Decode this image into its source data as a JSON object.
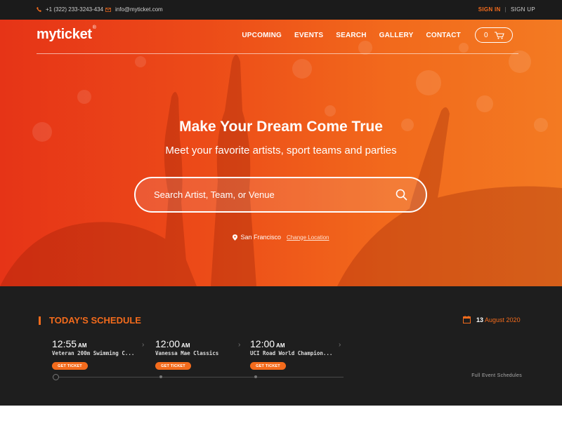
{
  "topbar": {
    "phone": "+1 (322) 233-3243-434",
    "email": "info@myticket.com",
    "sign_in": "SIGN IN",
    "separator": "|",
    "sign_up": "SIGN UP"
  },
  "header": {
    "logo": "myticket",
    "logo_mark": "®",
    "nav": [
      "UPCOMING",
      "EVENTS",
      "SEARCH",
      "GALLERY",
      "CONTACT"
    ],
    "cart_count": "0"
  },
  "hero": {
    "title": "Make Your Dream Come True",
    "subtitle": "Meet your favorite artists, sport teams and parties",
    "search_placeholder": "Search Artist, Team, or Venue",
    "location": "San Francisco",
    "change_location": "Change Location"
  },
  "schedule": {
    "title": "TODAY'S SCHEDULE",
    "date_day": "13",
    "date_rest": "August 2020",
    "events": [
      {
        "time": "12:55",
        "ampm": "AM",
        "name": "Veteran 200m Swimming C...",
        "button": "GET TICKET"
      },
      {
        "time": "12:00",
        "ampm": "AM",
        "name": "Vanessa Mae Classics",
        "button": "GET TICKET"
      },
      {
        "time": "12:00",
        "ampm": "AM",
        "name": "UCI Road World Champion...",
        "button": "GET TICKET"
      }
    ],
    "full_schedule_link": "Full Event Schedules"
  },
  "colors": {
    "accent": "#f36b1c",
    "hero_start": "#e63417",
    "hero_end": "#f37a22",
    "dark": "#1e1e1e"
  }
}
